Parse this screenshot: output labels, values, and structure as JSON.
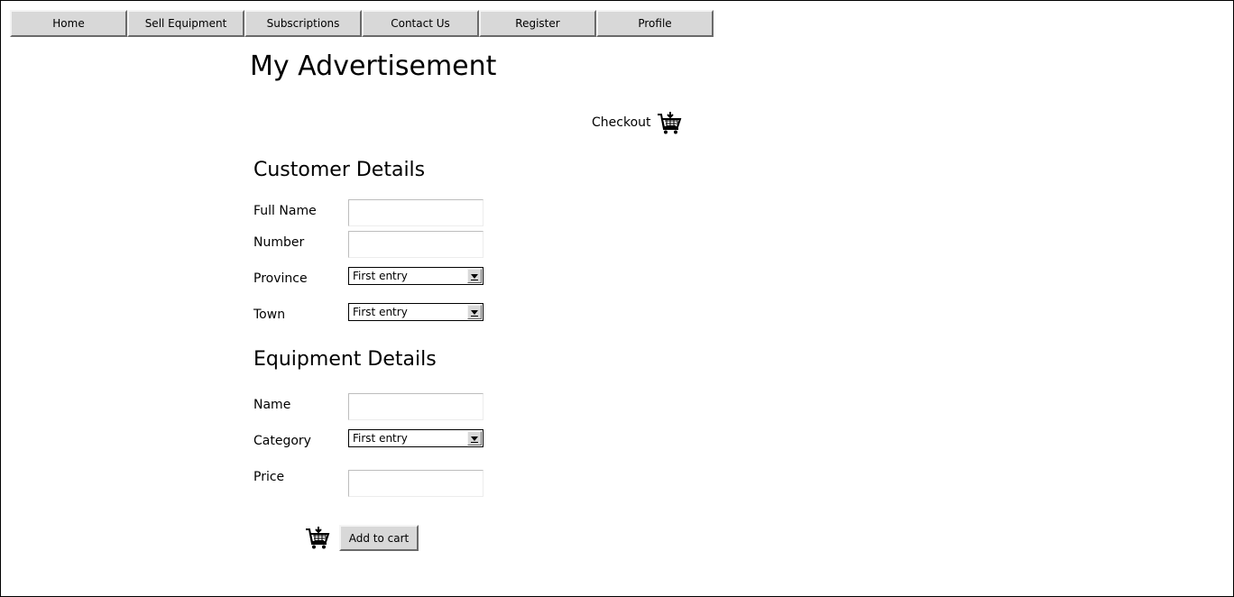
{
  "nav": {
    "items": [
      "Home",
      "Sell Equipment",
      "Subscriptions",
      "Contact Us",
      "Register",
      "Profile"
    ]
  },
  "page": {
    "title": "My Advertisement"
  },
  "checkout": {
    "label": "Checkout",
    "icon": "shopping-cart-icon"
  },
  "customer": {
    "title": "Customer Details",
    "full_name": {
      "label": "Full Name",
      "value": ""
    },
    "number": {
      "label": "Number",
      "value": ""
    },
    "province": {
      "label": "Province",
      "value": "First entry"
    },
    "town": {
      "label": "Town",
      "value": "First entry"
    }
  },
  "equipment": {
    "title": "Equipment Details",
    "name": {
      "label": "Name",
      "value": ""
    },
    "category": {
      "label": "Category",
      "value": "First entry"
    },
    "price": {
      "label": "Price",
      "value": ""
    }
  },
  "add_to_cart": {
    "label": "Add to cart",
    "icon": "shopping-cart-icon"
  }
}
